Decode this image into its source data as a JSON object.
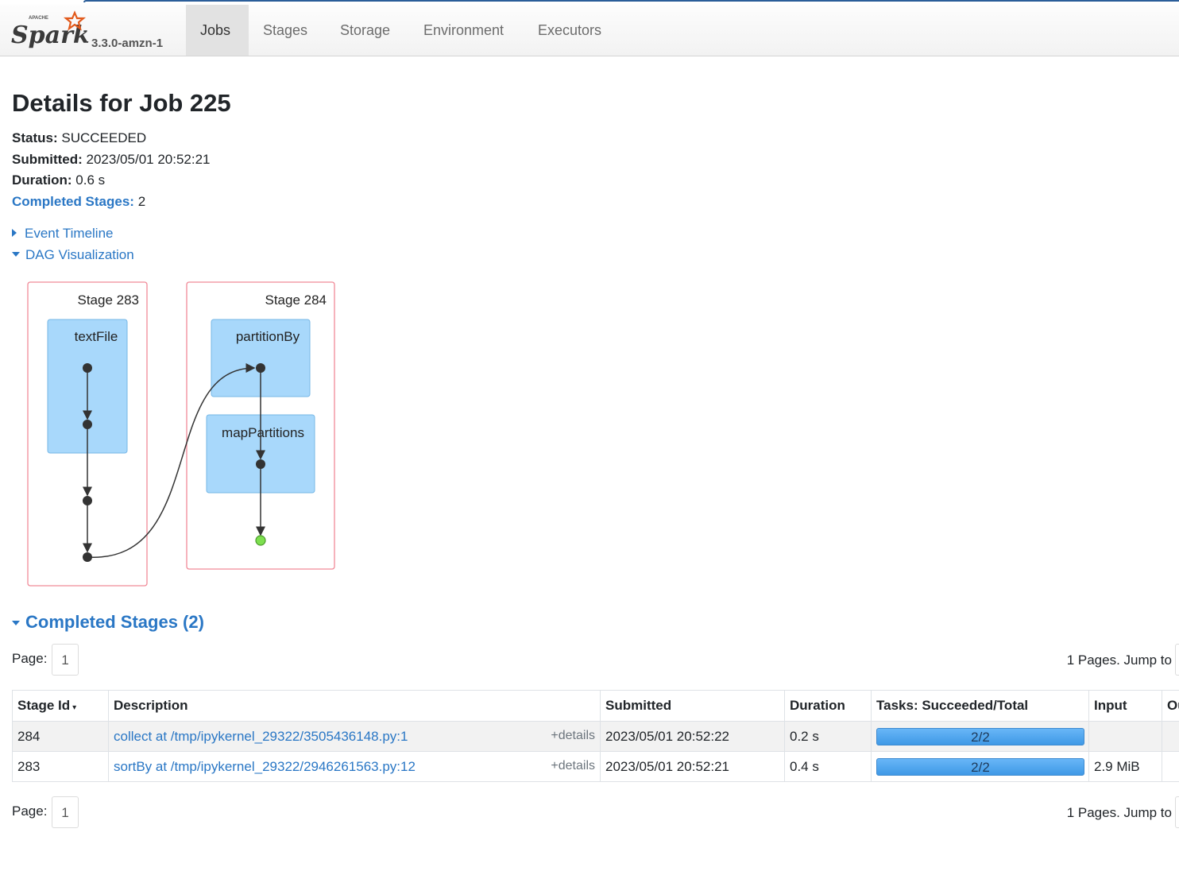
{
  "brand": {
    "apache": "APACHE",
    "logo": "Spark",
    "version": "3.3.0-amzn-1"
  },
  "nav": [
    {
      "label": "Jobs",
      "active": true
    },
    {
      "label": "Stages"
    },
    {
      "label": "Storage"
    },
    {
      "label": "Environment"
    },
    {
      "label": "Executors"
    }
  ],
  "job": {
    "title": "Details for Job 225",
    "status_label": "Status:",
    "status": "SUCCEEDED",
    "submitted_label": "Submitted:",
    "submitted": "2023/05/01 20:52:21",
    "duration_label": "Duration:",
    "duration": "0.6 s",
    "completed_stages_label": "Completed Stages:",
    "completed_stages": "2"
  },
  "toggles": {
    "event_timeline": "Event Timeline",
    "dag_visualization": "DAG Visualization"
  },
  "dag": {
    "stages": [
      {
        "label": "Stage 283",
        "ops": [
          "textFile"
        ]
      },
      {
        "label": "Stage 284",
        "ops": [
          "partitionBy",
          "mapPartitions"
        ]
      }
    ]
  },
  "completed_section": {
    "title": "Completed Stages (2)"
  },
  "pager": {
    "label": "Page:",
    "current": "1",
    "jump_text": "1 Pages. Jump to"
  },
  "table": {
    "headers": [
      "Stage Id",
      "Description",
      "Submitted",
      "Duration",
      "Tasks: Succeeded/Total",
      "Input",
      "Output"
    ],
    "sort_indicator": "▾",
    "details_label": "+details",
    "rows": [
      {
        "id": "284",
        "description": "collect at /tmp/ipykernel_29322/3505436148.py:1",
        "submitted": "2023/05/01 20:52:22",
        "duration": "0.2 s",
        "tasks": "2/2",
        "tasks_done_fraction": 1.0,
        "input": ""
      },
      {
        "id": "283",
        "description": "sortBy at /tmp/ipykernel_29322/2946261563.py:12",
        "submitted": "2023/05/01 20:52:21",
        "duration": "0.4 s",
        "tasks": "2/2",
        "tasks_done_fraction": 1.0,
        "input": "2.9 MiB"
      }
    ]
  },
  "colors": {
    "link": "#2a77c5",
    "stage_border": "#f08a98",
    "op_fill": "#a8d8fb",
    "op_border": "#76b7e6",
    "final_node": "#7ddf4f"
  }
}
